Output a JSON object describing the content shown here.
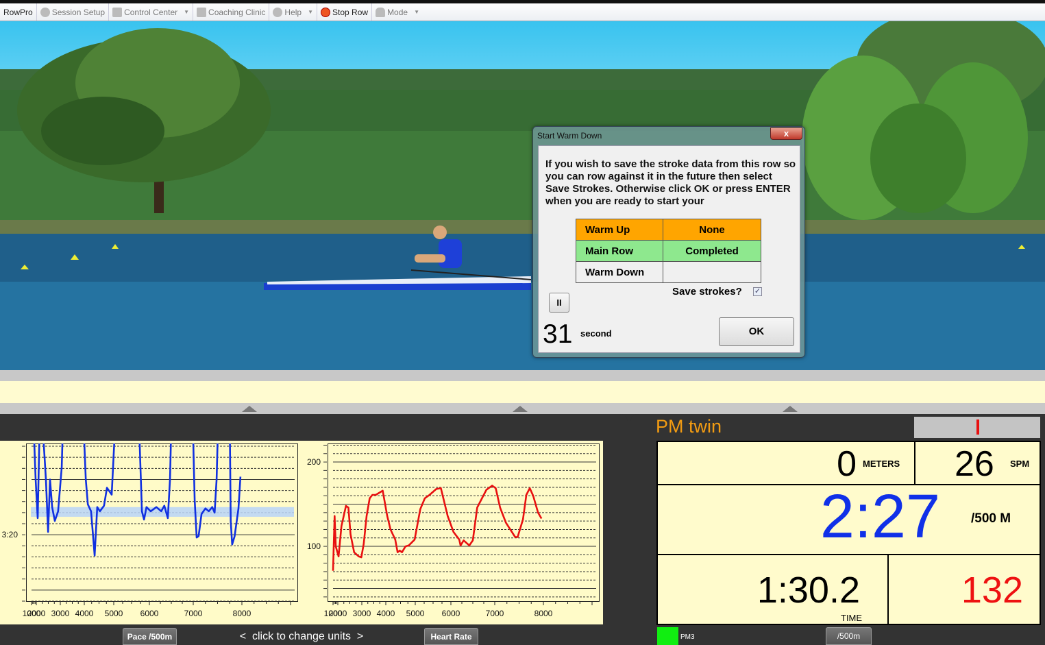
{
  "toolbar": {
    "app": "RowPro",
    "items": [
      {
        "label": "Session Setup",
        "icon": "gear-icon"
      },
      {
        "label": "Control Center",
        "icon": "control-center-icon"
      },
      {
        "label": "Coaching Clinic",
        "icon": "coaching-icon"
      },
      {
        "label": "Help",
        "icon": "help-icon"
      },
      {
        "label": "Stop Row",
        "icon": "stop-icon"
      },
      {
        "label": "Mode",
        "icon": "person-icon"
      }
    ]
  },
  "dialog": {
    "title": "Start Warm Down",
    "close": "x",
    "message": "If you wish to save the stroke data from this row so you can row against it in the future then select Save Strokes.  Otherwise click OK or press ENTER when you are ready to start your",
    "rows": [
      {
        "label": "Warm Up",
        "value": "None",
        "color": "#ffa500"
      },
      {
        "label": "Main Row",
        "value": "Completed",
        "color": "#8ee88e"
      },
      {
        "label": "Warm Down",
        "value": "",
        "color": "#f0f0f0"
      }
    ],
    "save_label": "Save strokes?",
    "save_checked": true,
    "pause": "II",
    "countdown": "31",
    "countdown_unit": "second",
    "ok": "OK"
  },
  "charts_footer": {
    "pace_button": "Pace /500m",
    "change_units": "<  click to change units  >",
    "hr_button": "Heart Rate"
  },
  "chart_data": [
    {
      "type": "line",
      "title": "",
      "xlabel": "",
      "ylabel": "",
      "x_ticks": [
        1000,
        2000,
        3000,
        4000,
        5000,
        6000,
        7000,
        8000
      ],
      "x_tick_labels": [
        "1000",
        "2000",
        "3000",
        "4000",
        "5000",
        "6000",
        "7000",
        "8000"
      ],
      "y_tick_labels": [
        {
          "value": 200,
          "label": "3:20"
        }
      ],
      "y_unit": "seconds per 500m",
      "y_inverted": true,
      "ylim": [
        134,
        248
      ],
      "grid": true,
      "target_band": [
        180,
        187
      ],
      "color": "#1030e0",
      "band_color": "#b8d4f8",
      "points": [
        [
          1430,
          120
        ],
        [
          1860,
          160
        ],
        [
          2057,
          188
        ],
        [
          2140,
          120
        ],
        [
          2260,
          120
        ],
        [
          2400,
          160
        ],
        [
          2490,
          198
        ],
        [
          2570,
          160
        ],
        [
          2660,
          180
        ],
        [
          2770,
          190
        ],
        [
          2910,
          183
        ],
        [
          3060,
          151
        ],
        [
          3110,
          120
        ],
        [
          3970,
          120
        ],
        [
          4050,
          160
        ],
        [
          4120,
          178
        ],
        [
          4230,
          183
        ],
        [
          4350,
          215
        ],
        [
          4440,
          180
        ],
        [
          4530,
          183
        ],
        [
          4670,
          179
        ],
        [
          4770,
          166
        ],
        [
          4930,
          171
        ],
        [
          5040,
          120
        ],
        [
          5710,
          120
        ],
        [
          5790,
          183
        ],
        [
          5850,
          189
        ],
        [
          5920,
          180
        ],
        [
          6030,
          183
        ],
        [
          6160,
          180
        ],
        [
          6270,
          183
        ],
        [
          6340,
          179
        ],
        [
          6420,
          188
        ],
        [
          6470,
          160
        ],
        [
          6500,
          120
        ],
        [
          6990,
          120
        ],
        [
          7030,
          175
        ],
        [
          7070,
          202
        ],
        [
          7110,
          201
        ],
        [
          7170,
          185
        ],
        [
          7250,
          181
        ],
        [
          7320,
          183
        ],
        [
          7390,
          180
        ],
        [
          7440,
          184
        ],
        [
          7480,
          160
        ],
        [
          7510,
          120
        ],
        [
          7750,
          120
        ],
        [
          7770,
          190
        ],
        [
          7800,
          207
        ],
        [
          7850,
          201
        ],
        [
          7930,
          181
        ],
        [
          7970,
          158
        ]
      ]
    },
    {
      "type": "line",
      "title": "",
      "xlabel": "",
      "ylabel": "",
      "x_ticks": [
        1000,
        2000,
        3000,
        4000,
        5000,
        6000,
        7000,
        8000
      ],
      "x_tick_labels": [
        "1000",
        "2000",
        "3000",
        "4000",
        "5000",
        "6000",
        "7000",
        "8000"
      ],
      "y_tick_labels": [
        {
          "value": 200,
          "label": "200"
        },
        {
          "value": 100,
          "label": "100"
        }
      ],
      "ylim": [
        35,
        222
      ],
      "grid": true,
      "color": "#e81010",
      "points": [
        [
          1000,
          71
        ],
        [
          1330,
          136
        ],
        [
          1570,
          100
        ],
        [
          2030,
          88
        ],
        [
          2150,
          124
        ],
        [
          2340,
          148
        ],
        [
          2440,
          146
        ],
        [
          2530,
          114
        ],
        [
          2680,
          93
        ],
        [
          2870,
          88
        ],
        [
          2980,
          87
        ],
        [
          3080,
          103
        ],
        [
          3200,
          136
        ],
        [
          3330,
          157
        ],
        [
          3440,
          161
        ],
        [
          3580,
          161
        ],
        [
          3870,
          166
        ],
        [
          4050,
          136
        ],
        [
          4160,
          120
        ],
        [
          4320,
          108
        ],
        [
          4400,
          93
        ],
        [
          4470,
          95
        ],
        [
          4550,
          93
        ],
        [
          4670,
          100
        ],
        [
          4780,
          101
        ],
        [
          4980,
          108
        ],
        [
          5140,
          144
        ],
        [
          5270,
          157
        ],
        [
          5400,
          161
        ],
        [
          5590,
          168
        ],
        [
          5720,
          169
        ],
        [
          5910,
          136
        ],
        [
          6060,
          117
        ],
        [
          6190,
          108
        ],
        [
          6220,
          101
        ],
        [
          6290,
          107
        ],
        [
          6420,
          101
        ],
        [
          6500,
          107
        ],
        [
          6600,
          146
        ],
        [
          6710,
          157
        ],
        [
          6810,
          167
        ],
        [
          6940,
          172
        ],
        [
          7020,
          169
        ],
        [
          7110,
          146
        ],
        [
          7230,
          128
        ],
        [
          7420,
          111
        ],
        [
          7470,
          111
        ],
        [
          7580,
          132
        ],
        [
          7650,
          161
        ],
        [
          7720,
          169
        ],
        [
          7790,
          160
        ],
        [
          7890,
          140
        ],
        [
          7960,
          133
        ]
      ]
    }
  ],
  "monitor": {
    "title": "PM twin",
    "distance": "0",
    "distance_unit": "METERS",
    "rate": "26",
    "rate_unit": "SPM",
    "pace": "2:27",
    "pace_unit": "/500 M",
    "time": "1:30.2",
    "time_unit": "TIME",
    "heart_rate": "132",
    "device": "PM3",
    "units_button": "/500m",
    "colors": {
      "title": "#f39c12",
      "pace": "#1030e8",
      "heart_rate": "#ee1111",
      "status": "#11ee11"
    }
  }
}
